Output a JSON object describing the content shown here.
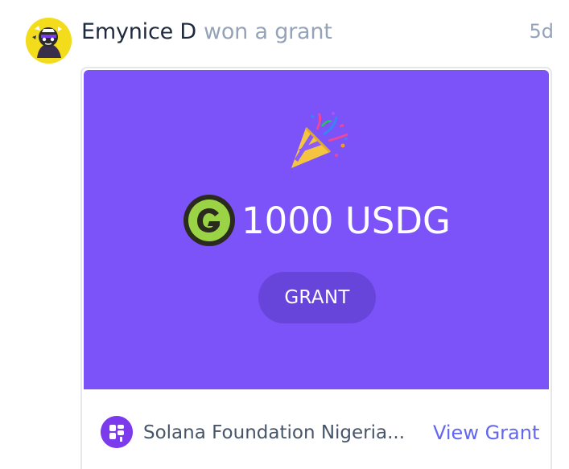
{
  "activity": {
    "user_name": "Emynice D",
    "action": "won a grant",
    "time_ago": "5d"
  },
  "card": {
    "icon": "party-popper-icon",
    "amount": "1000 USDG",
    "token_icon": "usdg-token-icon",
    "badge": "GRANT",
    "banner_color": "#7c53f8",
    "badge_color": "#6845da"
  },
  "footer": {
    "sponsor_name": "Solana Foundation Nigeria...",
    "sponsor_icon": "solana-foundation-logo-icon",
    "link_label": "View Grant",
    "link_color": "#6366f1"
  }
}
